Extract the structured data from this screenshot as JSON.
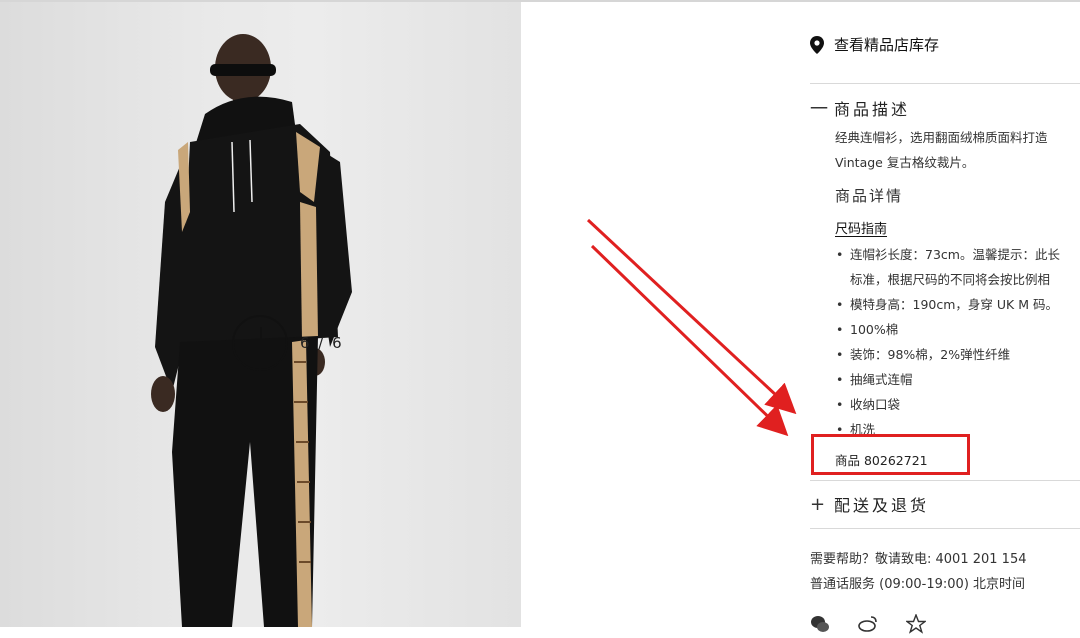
{
  "gallery": {
    "counter": "6 / 6",
    "zoom_icon": "plus-circle-icon"
  },
  "store": {
    "icon": "map-pin-icon",
    "label": "查看精品店库存"
  },
  "description": {
    "toggle": "一",
    "title": "商品描述",
    "text_line1": "经典连帽衫，选用翻面绒棉质面料打造",
    "text_line2": "Vintage 复古格纹裁片。",
    "details_heading": "商品详情",
    "size_guide": "尺码指南",
    "details": [
      "连帽衫长度：73cm。温馨提示：此长",
      "标准，根据尺码的不同将会按比例相",
      "模特身高：190cm，身穿 UK M 码。",
      "100%棉",
      "装饰：98%棉，2%弹性纤维",
      "抽绳式连帽",
      "收纳口袋",
      "机洗"
    ],
    "sku": "商品 80262721"
  },
  "shipping": {
    "toggle": "+",
    "title": "配送及退货"
  },
  "help": {
    "line1": "需要帮助？敬请致电: 4001 201 154",
    "line2": "普通话服务 (09:00-19:00) 北京时间"
  },
  "social_icons": [
    "wechat-icon",
    "weibo-icon",
    "star-icon"
  ],
  "colors": {
    "annotation_red": "#e02020",
    "divider": "#d9d9d9",
    "check_beige": "#c9a77a"
  }
}
